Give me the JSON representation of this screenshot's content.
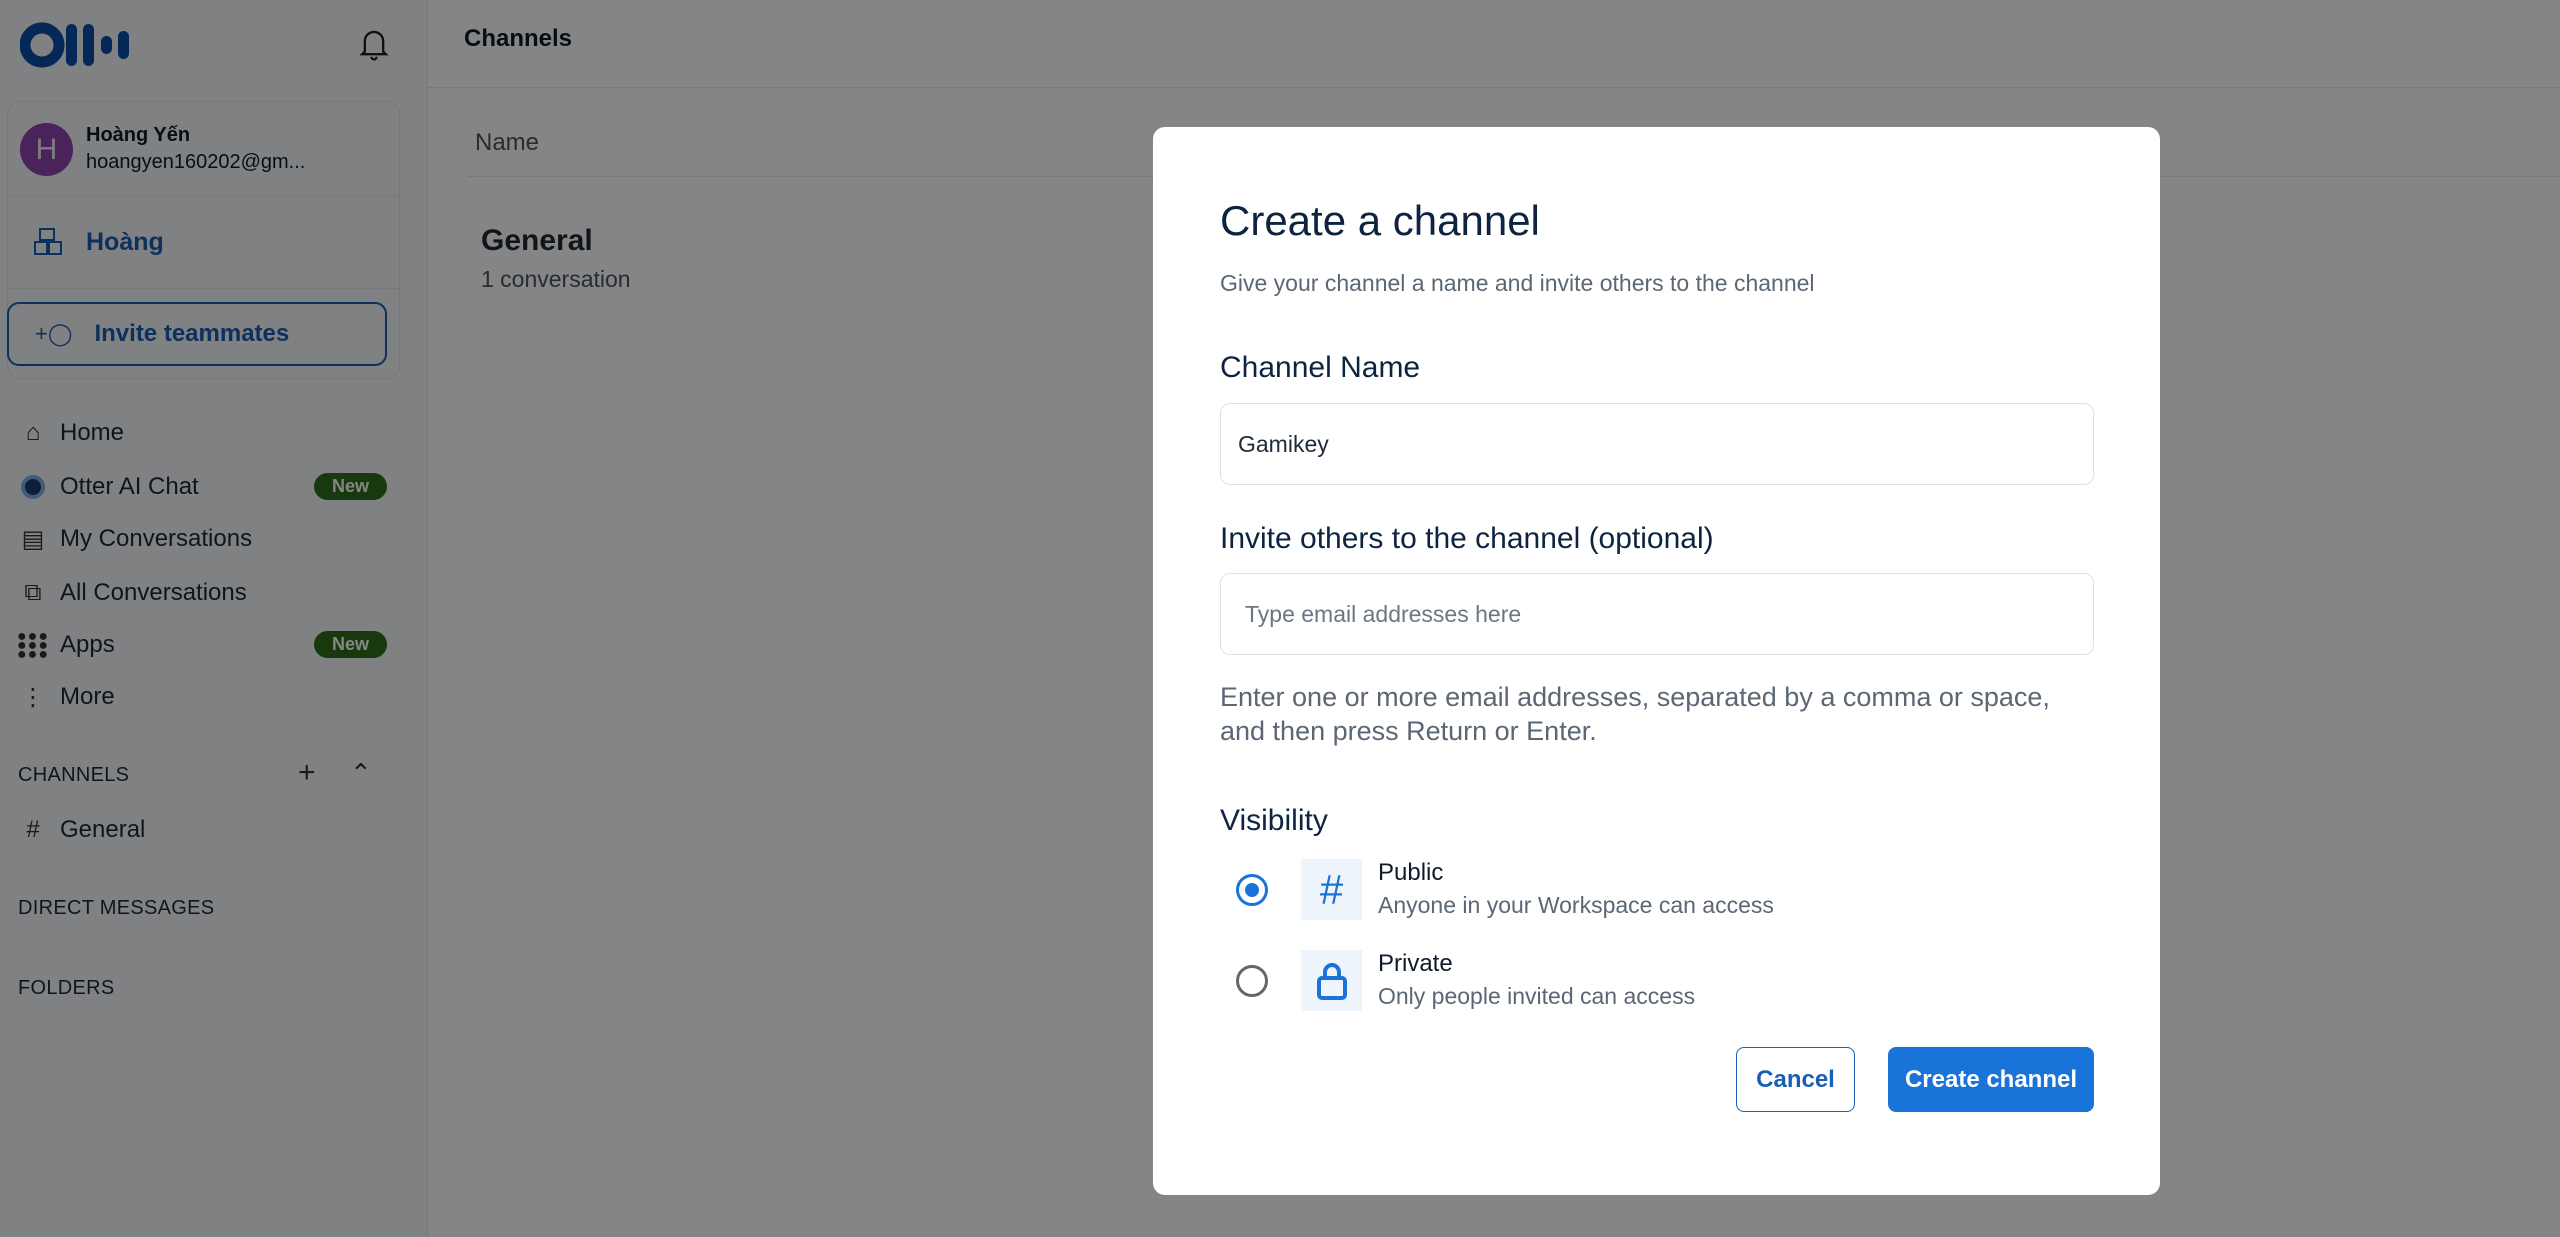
{
  "sidebar": {
    "user": {
      "initial": "H",
      "name": "Hoàng Yến",
      "email": "hoangyen160202@gm..."
    },
    "workspace": "Hoàng",
    "invite_label": "Invite teammates",
    "nav": [
      {
        "label": "Home",
        "icon": "home-icon"
      },
      {
        "label": "Otter AI Chat",
        "icon": "otter-ai-icon",
        "badge": "New"
      },
      {
        "label": "My Conversations",
        "icon": "document-icon"
      },
      {
        "label": "All Conversations",
        "icon": "documents-icon"
      },
      {
        "label": "Apps",
        "icon": "grid-icon",
        "badge": "New"
      },
      {
        "label": "More",
        "icon": "more-vertical-icon"
      }
    ],
    "channels_header": "CHANNELS",
    "channels": [
      "General"
    ],
    "direct_messages_header": "DIRECT MESSAGES",
    "folders_header": "FOLDERS"
  },
  "main": {
    "title": "Channels",
    "column_name": "Name",
    "rows": [
      {
        "name": "General",
        "meta": "1 conversation"
      }
    ]
  },
  "modal": {
    "title": "Create a channel",
    "subtitle": "Give your channel a name and invite others to the channel",
    "channel_name_label": "Channel Name",
    "channel_name_value": "Gamikey",
    "invite_label": "Invite others to the channel (optional)",
    "invite_placeholder": "Type email addresses here",
    "invite_help_1": "Enter one or more email addresses, separated by a comma or space,",
    "invite_help_2": "and then press Return or Enter.",
    "visibility_label": "Visibility",
    "options": [
      {
        "title": "Public",
        "desc": "Anyone in your Workspace can access",
        "selected": true
      },
      {
        "title": "Private",
        "desc": "Only people invited can access",
        "selected": false
      }
    ],
    "cancel": "Cancel",
    "create": "Create channel"
  },
  "colors": {
    "accent": "#1a73d9",
    "brand": "#0b4fa8",
    "badge": "#2f6b1c",
    "avatar": "#8e44ad"
  }
}
